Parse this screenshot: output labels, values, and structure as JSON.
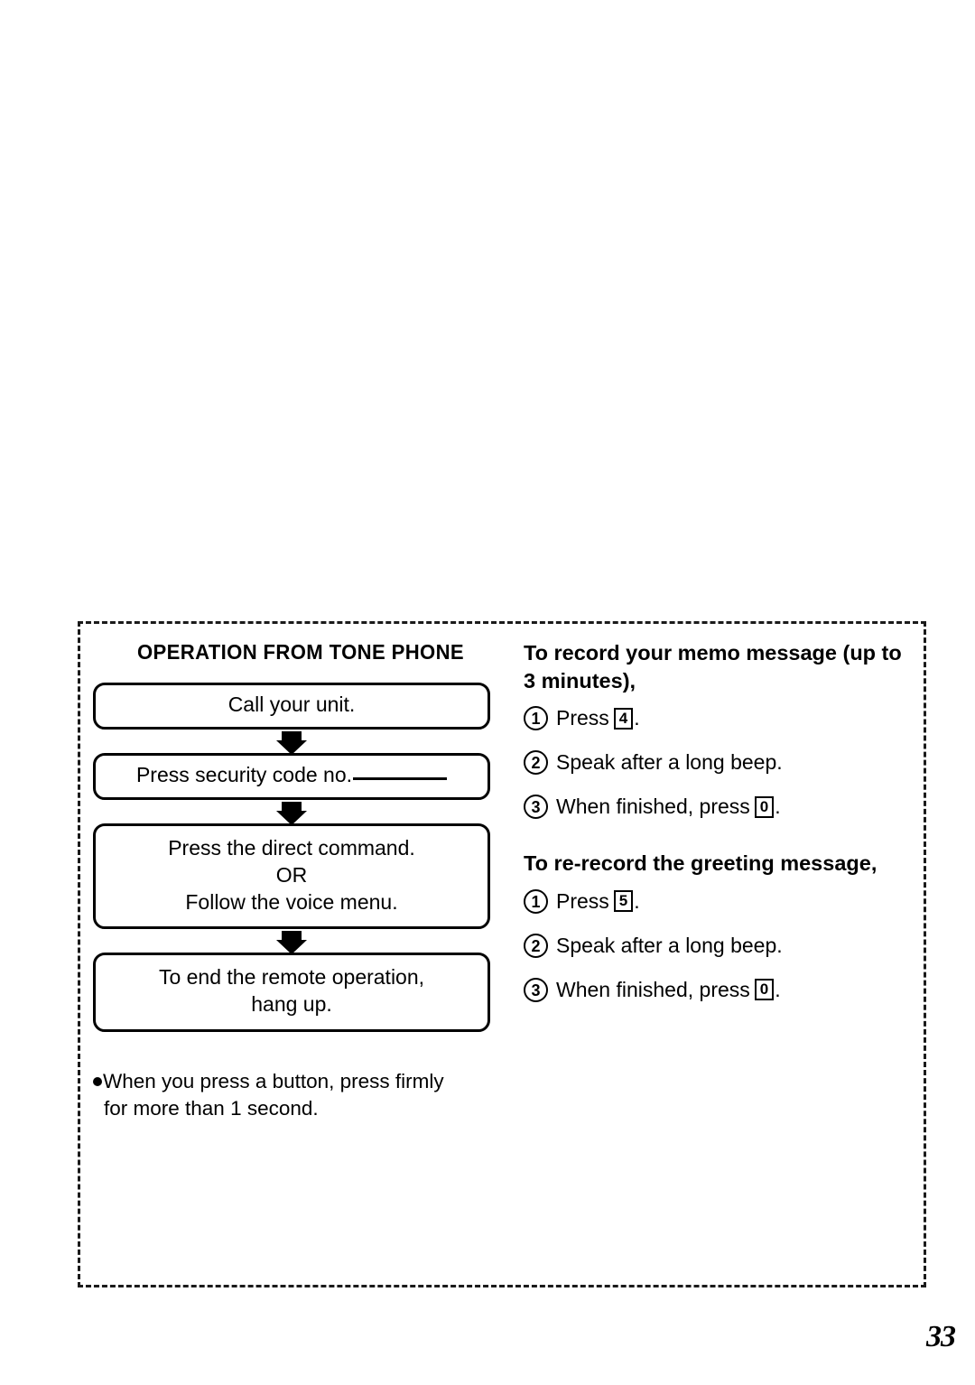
{
  "page": {
    "number": "33"
  },
  "panel": {
    "left_column": {
      "section_title": "OPERATION FROM TONE PHONE",
      "flow_steps": [
        {
          "lines": [
            "Call your unit."
          ],
          "has_blank_rule": false
        },
        {
          "lines": [
            "Press security code no."
          ],
          "has_blank_rule": true
        },
        {
          "lines": [
            "Press the direct command.",
            "OR",
            "Follow the voice menu."
          ],
          "has_blank_rule": false
        },
        {
          "lines": [
            "To end the remote operation,",
            "hang up."
          ],
          "has_blank_rule": false
        }
      ],
      "footnote": {
        "line1": "When you press a button, press firmly",
        "line2": "for more than 1 second."
      }
    },
    "right_column": {
      "procedures": [
        {
          "heading": "To record your memo message (up to 3 minutes),",
          "steps": [
            {
              "marker": "1",
              "text_before": "Press",
              "key": "4",
              "text_after": "."
            },
            {
              "marker": "2",
              "text_before": "Speak after a long beep.",
              "key": "",
              "text_after": ""
            },
            {
              "marker": "3",
              "text_before": "When finished, press",
              "key": "0",
              "text_after": "."
            }
          ]
        },
        {
          "heading": "To re-record the greeting message,",
          "steps": [
            {
              "marker": "1",
              "text_before": "Press",
              "key": "5",
              "text_after": "."
            },
            {
              "marker": "2",
              "text_before": "Speak after a long beep.",
              "key": "",
              "text_after": ""
            },
            {
              "marker": "3",
              "text_before": "When finished, press",
              "key": "0",
              "text_after": "."
            }
          ]
        }
      ]
    }
  },
  "colors": {
    "ink": "#000000",
    "paper": "#ffffff"
  }
}
